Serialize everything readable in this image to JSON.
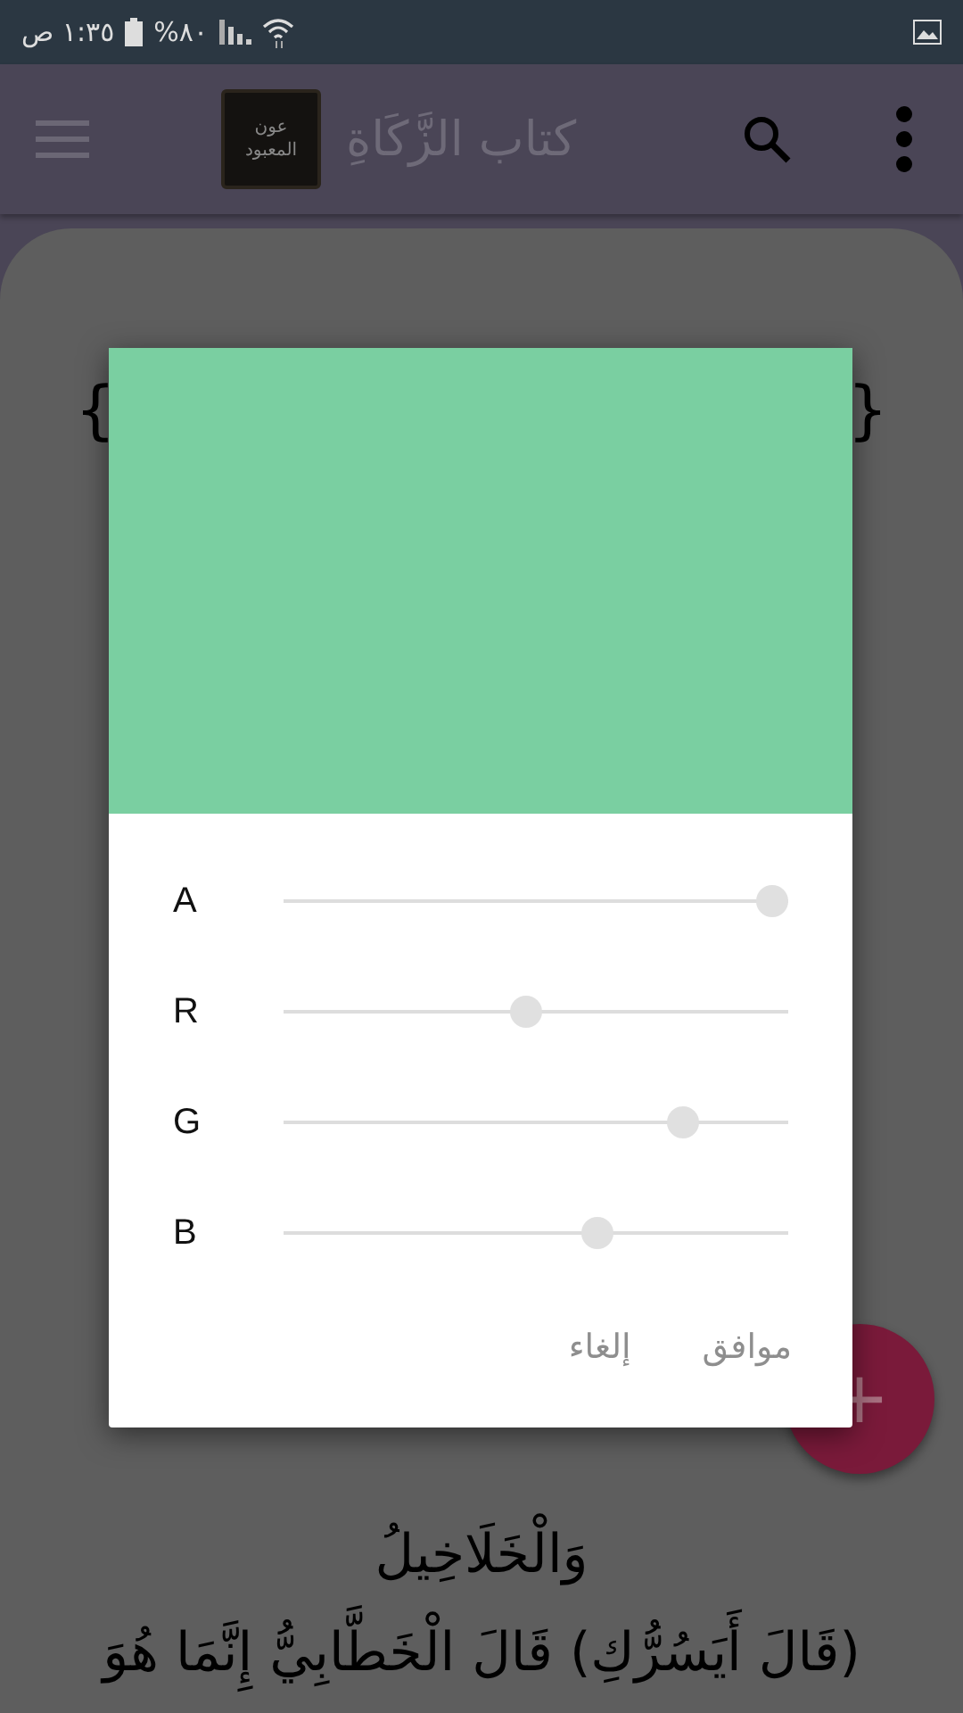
{
  "status_bar": {
    "time": "١:٣٥ ص",
    "battery": "%٨٠"
  },
  "app_bar": {
    "logo_text": "عون المعبود",
    "title": "كتاب الزَّكَاةِ"
  },
  "content": {
    "braces": [
      "}",
      "{"
    ],
    "lines": [
      "وَالْخَلَاخِيلُ",
      "(قَالَ أَيَسُرُّكِ) قَالَ الْخَطَّابِيُّ إِنَّمَا هُوَ"
    ]
  },
  "dialog": {
    "sliders": [
      {
        "label": "A",
        "level": 1.0
      },
      {
        "label": "R",
        "level": 0.48
      },
      {
        "label": "G",
        "level": 0.81
      },
      {
        "label": "B",
        "level": 0.63
      }
    ],
    "buttons": [
      {
        "label": "موافق",
        "disabled": true
      },
      {
        "label": "إلغاء",
        "disabled": true
      }
    ]
  },
  "fab": {
    "label": "+"
  }
}
